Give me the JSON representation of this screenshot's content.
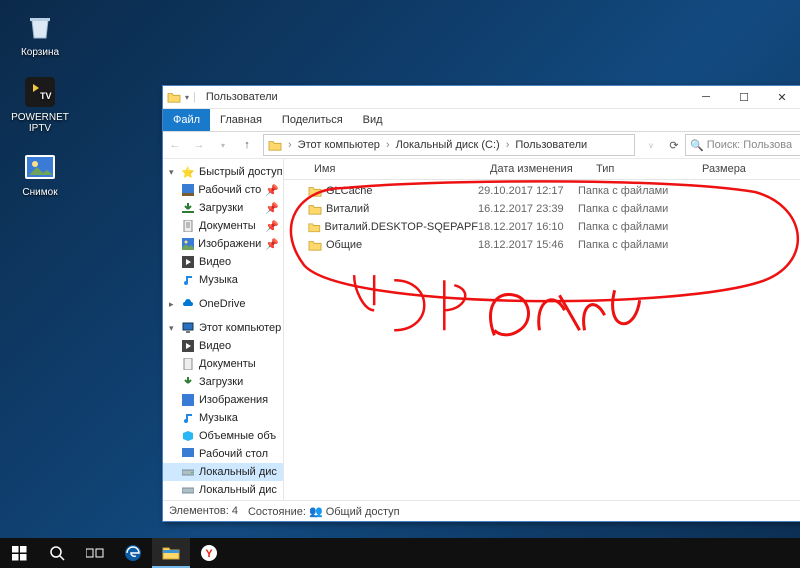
{
  "desktop": {
    "icons": [
      {
        "label": "Корзина",
        "name": "recycle-bin"
      },
      {
        "label": "POWERNET IPTV",
        "name": "powernet-iptv"
      },
      {
        "label": "Снимок",
        "name": "snapshot"
      }
    ]
  },
  "window": {
    "title": "Пользователи",
    "tabs": {
      "file": "Файл",
      "home": "Главная",
      "share": "Поделиться",
      "view": "Вид"
    },
    "nav": {
      "back": "←",
      "forward": "→",
      "up": "↑"
    },
    "breadcrumb": [
      "Этот компьютер",
      "Локальный диск (C:)",
      "Пользователи"
    ],
    "search_placeholder": "Поиск: Пользова",
    "columns": {
      "name": "Имя",
      "date": "Дата изменения",
      "type": "Тип",
      "size": "Размера"
    },
    "items": [
      {
        "name": "GLCache",
        "date": "29.10.2017 12:17",
        "type": "Папка с файлами"
      },
      {
        "name": "Виталий",
        "date": "16.12.2017 23:39",
        "type": "Папка с файлами"
      },
      {
        "name": "Виталий.DESKTOP-SQEPAPF",
        "date": "18.12.2017 16:10",
        "type": "Папка с файлами"
      },
      {
        "name": "Общие",
        "date": "18.12.2017 15:46",
        "type": "Папка с файлами"
      }
    ],
    "status": {
      "count": "Элементов: 4",
      "shared": "Состояние: 👥 Общий доступ"
    }
  },
  "sidebar": {
    "quick": {
      "label": "Быстрый доступ",
      "items": [
        {
          "label": "Рабочий сто",
          "pinned": true
        },
        {
          "label": "Загрузки",
          "pinned": true
        },
        {
          "label": "Документы",
          "pinned": true
        },
        {
          "label": "Изображени",
          "pinned": true
        },
        {
          "label": "Видео"
        },
        {
          "label": "Музыка"
        }
      ]
    },
    "onedrive": {
      "label": "OneDrive"
    },
    "pc": {
      "label": "Этот компьютер",
      "items": [
        {
          "label": "Видео"
        },
        {
          "label": "Документы"
        },
        {
          "label": "Загрузки"
        },
        {
          "label": "Изображения"
        },
        {
          "label": "Музыка"
        },
        {
          "label": "Объемные объ"
        },
        {
          "label": "Рабочий стол"
        },
        {
          "label": "Локальный дис",
          "selected": true
        },
        {
          "label": "Локальный дис"
        }
      ]
    }
  }
}
